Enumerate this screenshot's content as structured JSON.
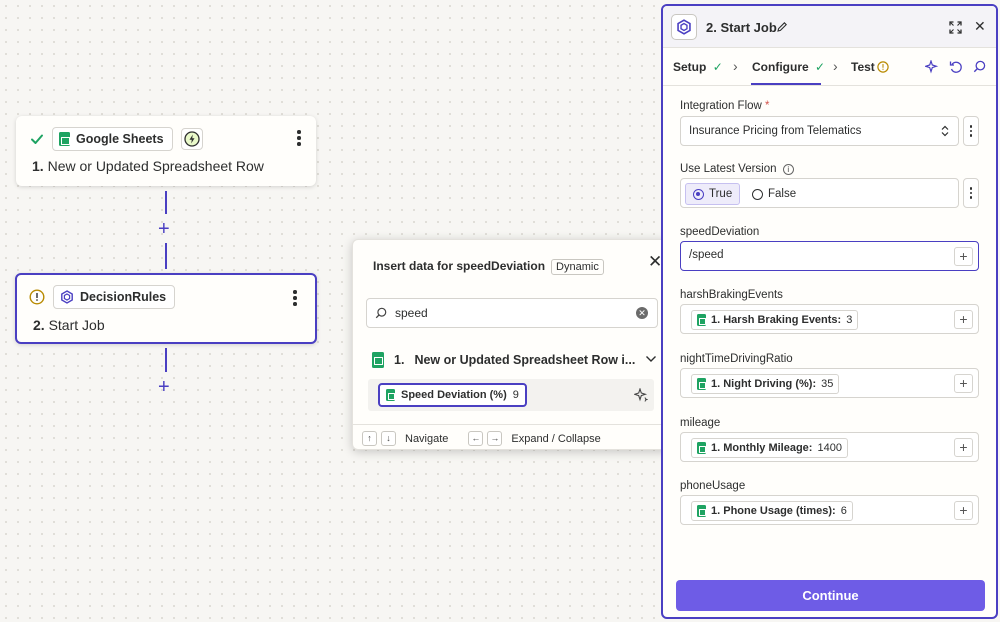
{
  "canvas": {
    "step1": {
      "app_name": "Google Sheets",
      "number": "1.",
      "title": "New or Updated Spreadsheet Row"
    },
    "step2": {
      "app_name": "DecisionRules",
      "number": "2.",
      "title": "Start Job"
    }
  },
  "popup": {
    "heading": "Insert data for speedDeviation",
    "badge": "Dynamic",
    "search": {
      "value": "speed",
      "placeholder": "Search"
    },
    "group": {
      "number": "1.",
      "title": "New or Updated Spreadsheet Row i..."
    },
    "result": {
      "label": "Speed Deviation (%)",
      "value": "9"
    },
    "footer": {
      "up_key": "↑",
      "down_key": "↓",
      "navigate": "Navigate",
      "left_key": "←",
      "right_key": "→",
      "expand": "Expand / Collapse"
    }
  },
  "panel": {
    "title": "2. Start Job",
    "tabs": {
      "setup": "Setup",
      "configure": "Configure",
      "test": "Test"
    },
    "fields": {
      "integration_flow": {
        "label": "Integration Flow",
        "required": "*",
        "value": "Insurance Pricing from Telematics"
      },
      "use_latest_version": {
        "label": "Use Latest Version",
        "option_true": "True",
        "option_false": "False",
        "selected": "True"
      },
      "speed_deviation": {
        "label": "speedDeviation",
        "value": "/speed"
      },
      "harsh_braking": {
        "label": "harshBrakingEvents",
        "pill_label": "1. Harsh Braking Events:",
        "pill_value": "3"
      },
      "night_time": {
        "label": "nightTimeDrivingRatio",
        "pill_label": "1. Night Driving (%):",
        "pill_value": "35"
      },
      "mileage": {
        "label": "mileage",
        "pill_label": "1. Monthly Mileage:",
        "pill_value": "1400"
      },
      "phone_usage": {
        "label": "phoneUsage",
        "pill_label": "1. Phone Usage (times):",
        "pill_value": "6"
      }
    },
    "continue_label": "Continue"
  },
  "colors": {
    "accent": "#4a3fc2",
    "button": "#6e5ce6",
    "success": "#1ea362",
    "warning": "#b88a00"
  }
}
